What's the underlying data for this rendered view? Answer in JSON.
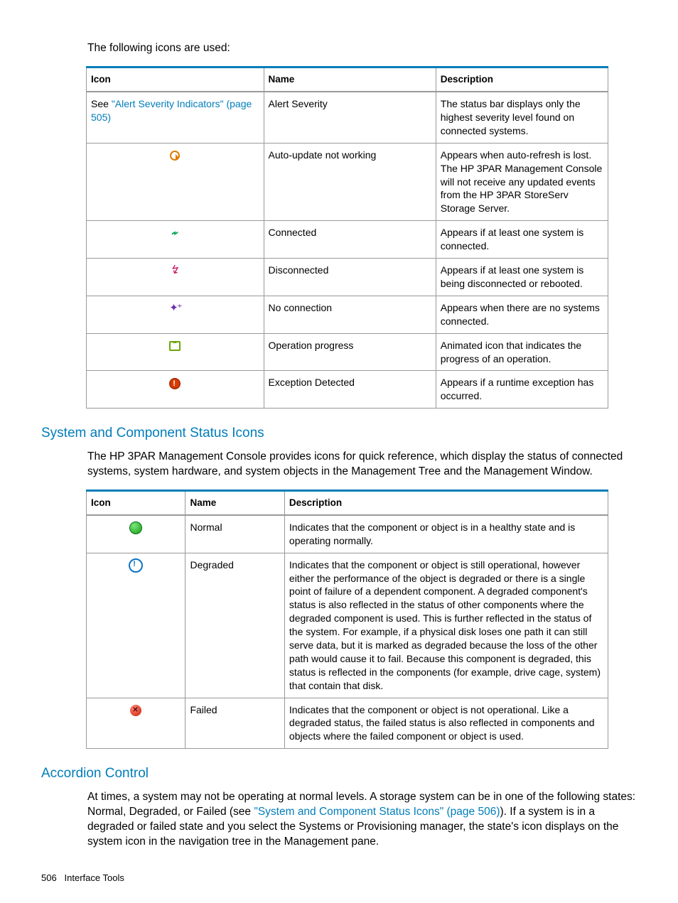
{
  "intro": "The following icons are used:",
  "table1": {
    "headers": {
      "icon": "Icon",
      "name": "Name",
      "description": "Description"
    },
    "rows": [
      {
        "icon_see_prefix": "See ",
        "icon_link": "\"Alert Severity Indicators\" (page 505)",
        "name": "Alert Severity",
        "description": "The status bar displays only the highest severity level found on connected systems."
      },
      {
        "icon": "auto-update-icon",
        "name": "Auto-update not working",
        "description": "Appears when auto-refresh is lost. The HP 3PAR Management Console will not receive any updated events from the HP 3PAR StoreServ Storage Server."
      },
      {
        "icon": "connected-icon",
        "name": "Connected",
        "description": "Appears if at least one system is connected."
      },
      {
        "icon": "disconnected-icon",
        "name": "Disconnected",
        "description": "Appears if at least one system is being disconnected or rebooted."
      },
      {
        "icon": "no-connection-icon",
        "name": "No connection",
        "description": "Appears when there are no systems connected."
      },
      {
        "icon": "operation-progress-icon",
        "name": "Operation progress",
        "description": "Animated icon that indicates the progress of an operation."
      },
      {
        "icon": "exception-detected-icon",
        "name": "Exception Detected",
        "description": "Appears if a runtime exception has occurred."
      }
    ]
  },
  "section1": {
    "heading": "System and Component Status Icons",
    "para": "The HP 3PAR Management Console provides icons for quick reference, which display the status of connected systems, system hardware, and system objects in the Management Tree and the Management Window."
  },
  "table2": {
    "headers": {
      "icon": "Icon",
      "name": "Name",
      "description": "Description"
    },
    "rows": [
      {
        "icon": "normal-icon",
        "name": "Normal",
        "description": "Indicates that the component or object is in a healthy state and is operating normally."
      },
      {
        "icon": "degraded-icon",
        "name": "Degraded",
        "description": "Indicates that the component or object is still operational, however either the performance of the object is degraded or there is a single point of failure of a dependent component. A degraded component's status is also reflected in the status of other components where the degraded component is used. This is further reflected in the status of the system. For example, if a physical disk loses one path it can still serve data, but it is marked as degraded because the loss of the other path would cause it to fail. Because this component is degraded, this status is reflected in the components (for example, drive cage, system) that contain that disk."
      },
      {
        "icon": "failed-icon",
        "name": "Failed",
        "description": "Indicates that the component or object is not operational. Like a degraded status, the failed status is also reflected in components and objects where the failed component or object is used."
      }
    ]
  },
  "section2": {
    "heading": "Accordion Control",
    "para_pre": "At times, a system may not be operating at normal levels. A storage system can be in one of the following states: Normal, Degraded, or Failed (see ",
    "para_link": "\"System and Component Status Icons\" (page 506)",
    "para_post": "). If a system is in a degraded or failed state and you select the Systems or Provisioning manager, the state's icon displays on the system icon in the navigation tree in the Management pane."
  },
  "footer": {
    "page": "506",
    "label": "Interface Tools"
  }
}
